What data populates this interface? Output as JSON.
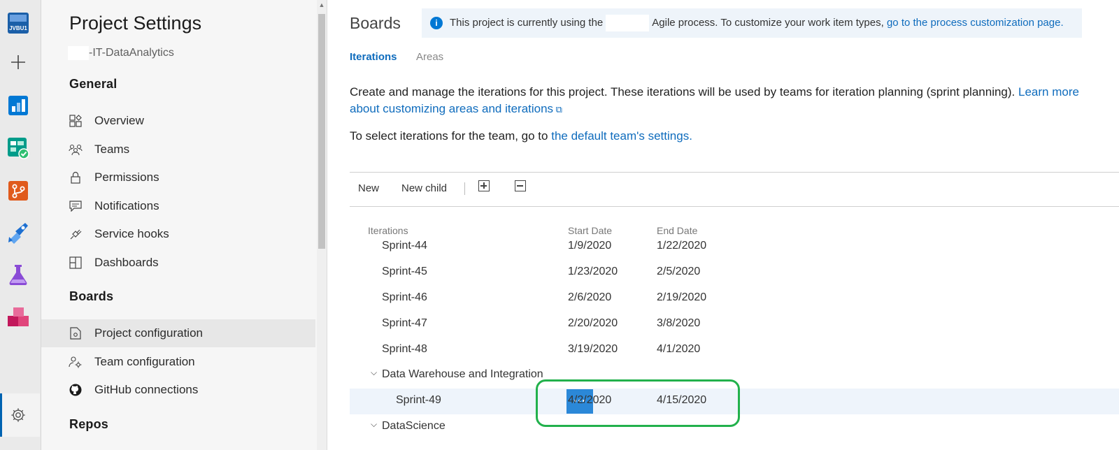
{
  "rail": {
    "items": [
      {
        "name": "org-logo",
        "text": "JVBU1"
      },
      {
        "name": "add-icon"
      },
      {
        "name": "overview-icon"
      },
      {
        "name": "boards-icon"
      },
      {
        "name": "repos-icon"
      },
      {
        "name": "pipelines-icon"
      },
      {
        "name": "test-plans-icon"
      },
      {
        "name": "artifacts-icon"
      }
    ],
    "settings_icon": "gear-icon"
  },
  "nav": {
    "title": "Project Settings",
    "project": "-IT-DataAnalytics",
    "sections": [
      {
        "heading": "General",
        "items": [
          "Overview",
          "Teams",
          "Permissions",
          "Notifications",
          "Service hooks",
          "Dashboards"
        ]
      },
      {
        "heading": "Boards",
        "items": [
          "Project configuration",
          "Team configuration",
          "GitHub connections"
        ]
      },
      {
        "heading": "Repos",
        "items": []
      }
    ],
    "active_item": "Project configuration"
  },
  "main": {
    "title": "Boards",
    "banner": {
      "prefix": "This project is currently using the",
      "suffix": "Agile process. To customize your work item types,",
      "link": "go to the process customization page."
    },
    "tabs": [
      "Iterations",
      "Areas"
    ],
    "description": {
      "text": "Create and manage the iterations for this project. These iterations will be used by teams for iteration planning (sprint planning).",
      "link_a": "Learn more",
      "link_b": "about customizing areas and iterations"
    },
    "team_line": {
      "text": "To select iterations for the team, go to",
      "link": "the default team's settings."
    },
    "toolbar": {
      "new": "New",
      "new_child": "New child"
    },
    "columns": {
      "iterations": "Iterations",
      "start": "Start Date",
      "end": "End Date"
    },
    "rows": [
      {
        "name": "Sprint-44",
        "start": "1/9/2020",
        "end": "1/22/2020"
      },
      {
        "name": "Sprint-45",
        "start": "1/23/2020",
        "end": "2/5/2020"
      },
      {
        "name": "Sprint-46",
        "start": "2/6/2020",
        "end": "2/19/2020"
      },
      {
        "name": "Sprint-47",
        "start": "2/20/2020",
        "end": "3/8/2020"
      },
      {
        "name": "Sprint-48",
        "start": "3/19/2020",
        "end": "4/1/2020"
      }
    ],
    "group1": "Data Warehouse and Integration",
    "selected_row": {
      "name": "Sprint-49",
      "start": "4/2/2020",
      "end": "4/15/2020",
      "more": "···"
    },
    "group2": "DataScience"
  }
}
